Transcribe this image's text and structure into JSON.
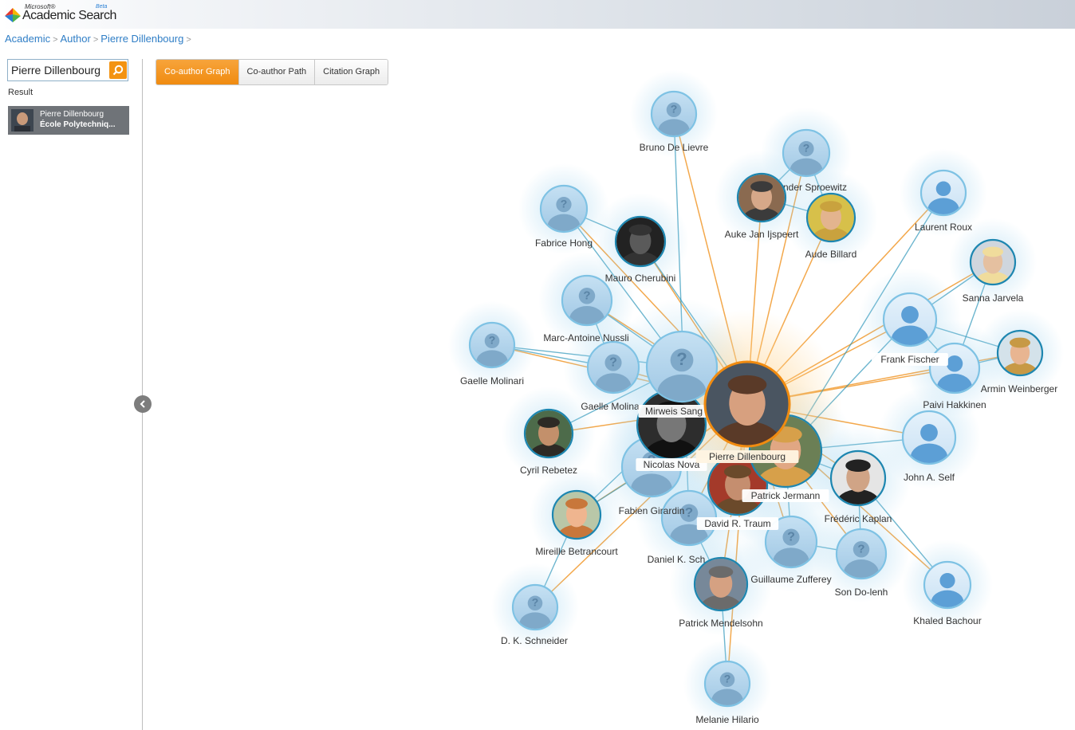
{
  "header": {
    "brand_small": "Microsoft®",
    "brand_main": "Academic Search",
    "brand_badge": "Beta"
  },
  "breadcrumb": [
    "Academic",
    "Author",
    "Pierre Dillenbourg"
  ],
  "search": {
    "value": "Pierre Dillenbourg"
  },
  "results": {
    "label": "Result",
    "items": [
      {
        "name": "Pierre Dillenbourg",
        "affiliation": "École Polytechniq..."
      }
    ]
  },
  "tabs": [
    {
      "label": "Co-author Graph",
      "active": true
    },
    {
      "label": "Co-author Path",
      "active": false
    },
    {
      "label": "Citation Graph",
      "active": false
    }
  ],
  "graph": {
    "center": "Pierre Dillenbourg",
    "nodes": [
      {
        "name": "Bruno De Lievre",
        "avatar": "unknown-avatar"
      },
      {
        "name": "Alexander Sproewitz",
        "avatar": "unknown-avatar",
        "label": "nder Sproewitz"
      },
      {
        "name": "Auke Jan Ijspeert",
        "avatar": "photo"
      },
      {
        "name": "Aude Billard",
        "avatar": "photo"
      },
      {
        "name": "Laurent Roux",
        "avatar": "generic-avatar"
      },
      {
        "name": "Fabrice Hong",
        "avatar": "unknown-avatar"
      },
      {
        "name": "Mauro Cherubini",
        "avatar": "photo"
      },
      {
        "name": "Sanna Jarvela",
        "avatar": "photo"
      },
      {
        "name": "Marc-Antoine Nussli",
        "avatar": "unknown-avatar"
      },
      {
        "name": "Frank Fischer",
        "avatar": "generic-avatar"
      },
      {
        "name": "Gaelle Molinari",
        "avatar": "unknown-avatar"
      },
      {
        "name": "Gaelle Molina",
        "avatar": "unknown-avatar"
      },
      {
        "name": "Mirweis Sangin",
        "avatar": "unknown-avatar",
        "label": "Mirweis Sang"
      },
      {
        "name": "Paivi Hakkinen",
        "avatar": "generic-avatar"
      },
      {
        "name": "Armin Weinberger",
        "avatar": "photo"
      },
      {
        "name": "Cyril Rebetez",
        "avatar": "photo"
      },
      {
        "name": "Nicolas Nova",
        "avatar": "photo"
      },
      {
        "name": "John A. Self",
        "avatar": "generic-avatar"
      },
      {
        "name": "Patrick Jermann",
        "avatar": "photo"
      },
      {
        "name": "Frédéric Kaplan",
        "avatar": "photo"
      },
      {
        "name": "Fabien Girardin",
        "avatar": "unknown-avatar"
      },
      {
        "name": "Mireille Betrancourt",
        "avatar": "photo"
      },
      {
        "name": "David R. Traum",
        "avatar": "photo"
      },
      {
        "name": "Daniel K. Schneider",
        "avatar": "unknown-avatar",
        "label": "Daniel K. Sch"
      },
      {
        "name": "Guillaume Zufferey",
        "avatar": "unknown-avatar"
      },
      {
        "name": "Son Do-lenh",
        "avatar": "unknown-avatar"
      },
      {
        "name": "Khaled Bachour",
        "avatar": "generic-avatar"
      },
      {
        "name": "D. K. Schneider",
        "avatar": "unknown-avatar"
      },
      {
        "name": "Patrick Mendelsohn",
        "avatar": "photo"
      },
      {
        "name": "Melanie Hilario",
        "avatar": "unknown-avatar"
      }
    ]
  },
  "colors": {
    "accent_orange": "#f08b10",
    "link_blue": "#2f7ec6",
    "edge_teal": "#1f8fb5",
    "node_blue": "#6aa9d8"
  }
}
